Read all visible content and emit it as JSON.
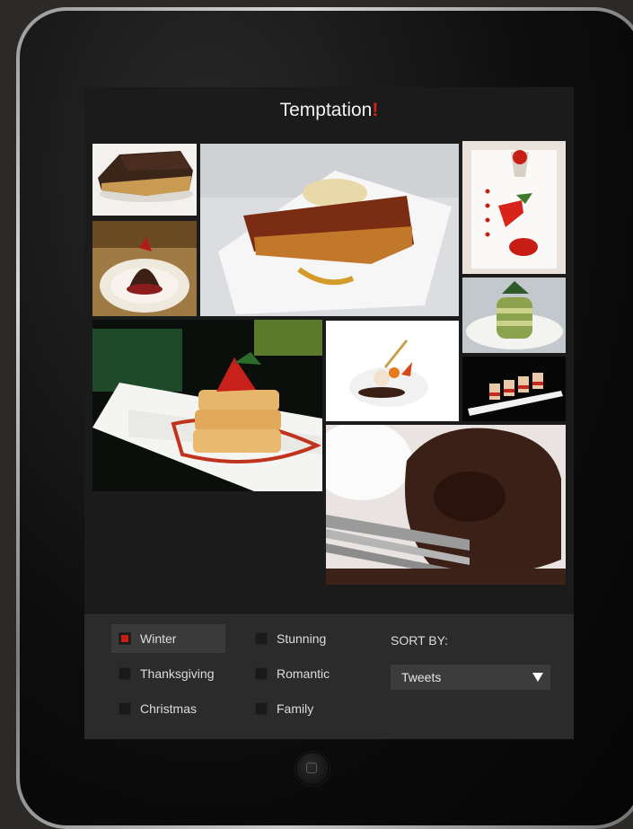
{
  "app": {
    "title": "Temptation",
    "title_mark": "!"
  },
  "photos": [
    {
      "name": "dessert-photo-brownie-slice"
    },
    {
      "name": "dessert-photo-chocolate-mousse"
    },
    {
      "name": "dessert-photo-caramel-tart"
    },
    {
      "name": "dessert-photo-strawberry-plate"
    },
    {
      "name": "dessert-photo-green-tea-stack"
    },
    {
      "name": "dessert-photo-petits-fours"
    },
    {
      "name": "dessert-photo-strawberry-napoleon"
    },
    {
      "name": "dessert-photo-chocolate-sphere"
    },
    {
      "name": "dessert-photo-lava-cake"
    }
  ],
  "filters": {
    "col1": [
      {
        "label": "Winter",
        "checked": true
      },
      {
        "label": "Thanksgiving",
        "checked": false
      },
      {
        "label": "Christmas",
        "checked": false
      }
    ],
    "col2": [
      {
        "label": "Stunning",
        "checked": false
      },
      {
        "label": "Romantic",
        "checked": false
      },
      {
        "label": "Family",
        "checked": false
      }
    ]
  },
  "sort": {
    "label": "SORT BY:",
    "selected": "Tweets"
  },
  "colors": {
    "accent": "#c81d15",
    "title_mark": "#d8231a"
  }
}
